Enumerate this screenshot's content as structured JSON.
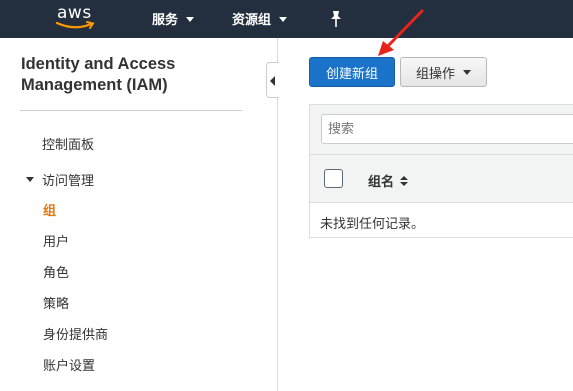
{
  "header": {
    "logo": "aws",
    "services_label": "服务",
    "resource_groups_label": "资源组",
    "pin_icon": "pin-icon"
  },
  "sidebar": {
    "title": "Identity and Access Management (IAM)",
    "dashboard": "控制面板",
    "access_management": "访问管理",
    "items": [
      {
        "label": "组",
        "active": true
      },
      {
        "label": "用户",
        "active": false
      },
      {
        "label": "角色",
        "active": false
      },
      {
        "label": "策略",
        "active": false
      },
      {
        "label": "身份提供商",
        "active": false
      },
      {
        "label": "账户设置",
        "active": false
      }
    ]
  },
  "toolbar": {
    "create_group_label": "创建新组",
    "group_actions_label": "组操作"
  },
  "table": {
    "search_placeholder": "搜索",
    "columns": [
      "组名"
    ],
    "empty_message": "未找到任何记录。"
  },
  "colors": {
    "nav_bg": "#232f3e",
    "primary_button": "#1a73c9",
    "active_link": "#e47911",
    "annotation_arrow": "#e8231a"
  }
}
